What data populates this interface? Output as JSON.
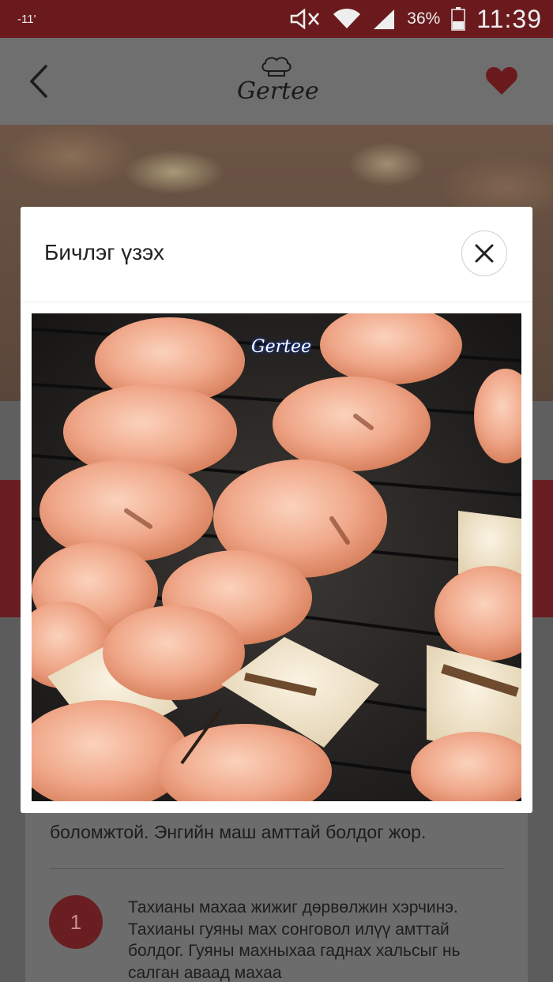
{
  "status_bar": {
    "left_indicator": "-11'",
    "battery_percent": "36%",
    "time": "11:39"
  },
  "app_bar": {
    "logo_text": "Gertee"
  },
  "modal": {
    "title": "Бичлэг үзэх",
    "watermark": "Gertee"
  },
  "recipe": {
    "description_tail": "боломжтой. Энгийн маш амттай болдог жор.",
    "steps": [
      {
        "number": "1",
        "text": "Тахианы махаа жижиг дөрвөлжин хэрчинэ. Тахианы гуяны мах сонговол илүү амттай болдог. Гуяны махныхаа гаднах хальсыг нь салган аваад махаа"
      }
    ]
  },
  "colors": {
    "brand_red": "#b8323a",
    "status_bar": "#6a1a1d",
    "overlay_tint": "rgba(0,0,0,0.5)"
  },
  "icons": {
    "back": "chevron-left-icon",
    "favorite": "heart-icon",
    "close": "close-icon"
  }
}
